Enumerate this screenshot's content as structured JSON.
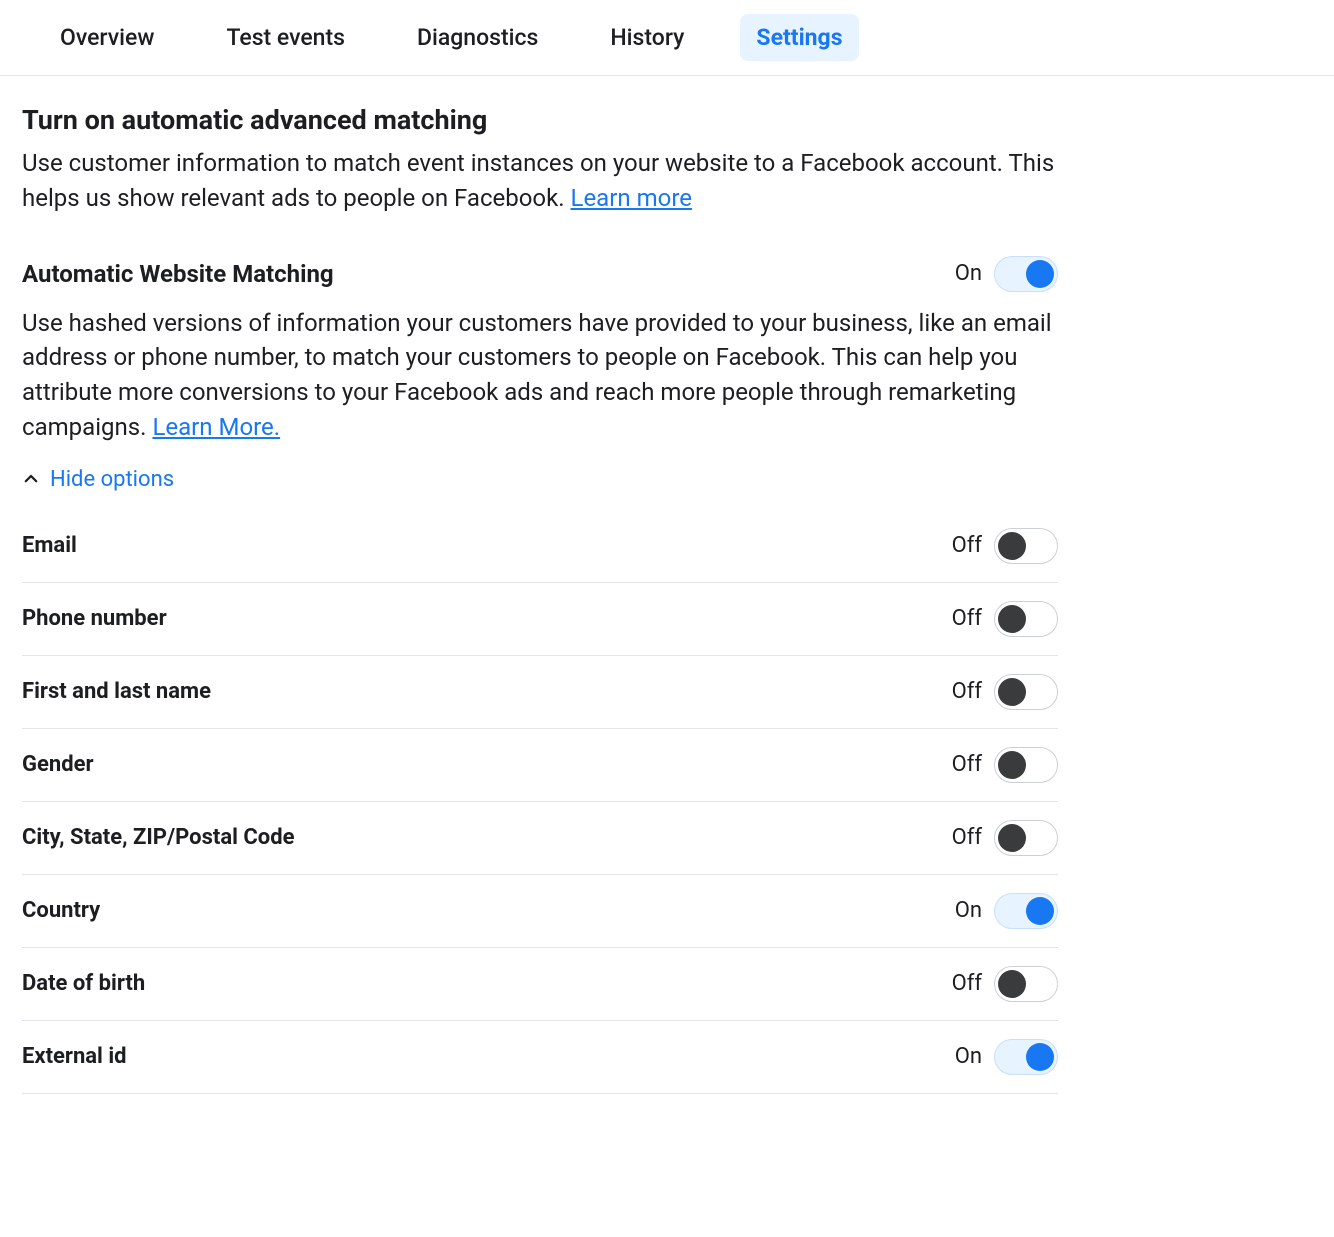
{
  "tabs": [
    {
      "label": "Overview",
      "active": false
    },
    {
      "label": "Test events",
      "active": false
    },
    {
      "label": "Diagnostics",
      "active": false
    },
    {
      "label": "History",
      "active": false
    },
    {
      "label": "Settings",
      "active": true
    }
  ],
  "section": {
    "title": "Turn on automatic advanced matching",
    "description": "Use customer information to match event instances on your website to a Facebook account. This helps us show relevant ads to people on Facebook. ",
    "learn_more": "Learn more"
  },
  "matching": {
    "title": "Automatic Website Matching",
    "state_label": "On",
    "on": true,
    "description": "Use hashed versions of information your customers have provided to your business, like an email address or phone number, to match your customers to people on Facebook. This can help you attribute more conversions to your Facebook ads and reach more people through remarketing campaigns. ",
    "learn_more": "Learn More."
  },
  "hide_options_label": "Hide options",
  "state_labels": {
    "on": "On",
    "off": "Off"
  },
  "options": [
    {
      "label": "Email",
      "on": false
    },
    {
      "label": "Phone number",
      "on": false
    },
    {
      "label": "First and last name",
      "on": false
    },
    {
      "label": "Gender",
      "on": false
    },
    {
      "label": "City, State, ZIP/Postal Code",
      "on": false
    },
    {
      "label": "Country",
      "on": true
    },
    {
      "label": "Date of birth",
      "on": false
    },
    {
      "label": "External id",
      "on": true
    }
  ]
}
